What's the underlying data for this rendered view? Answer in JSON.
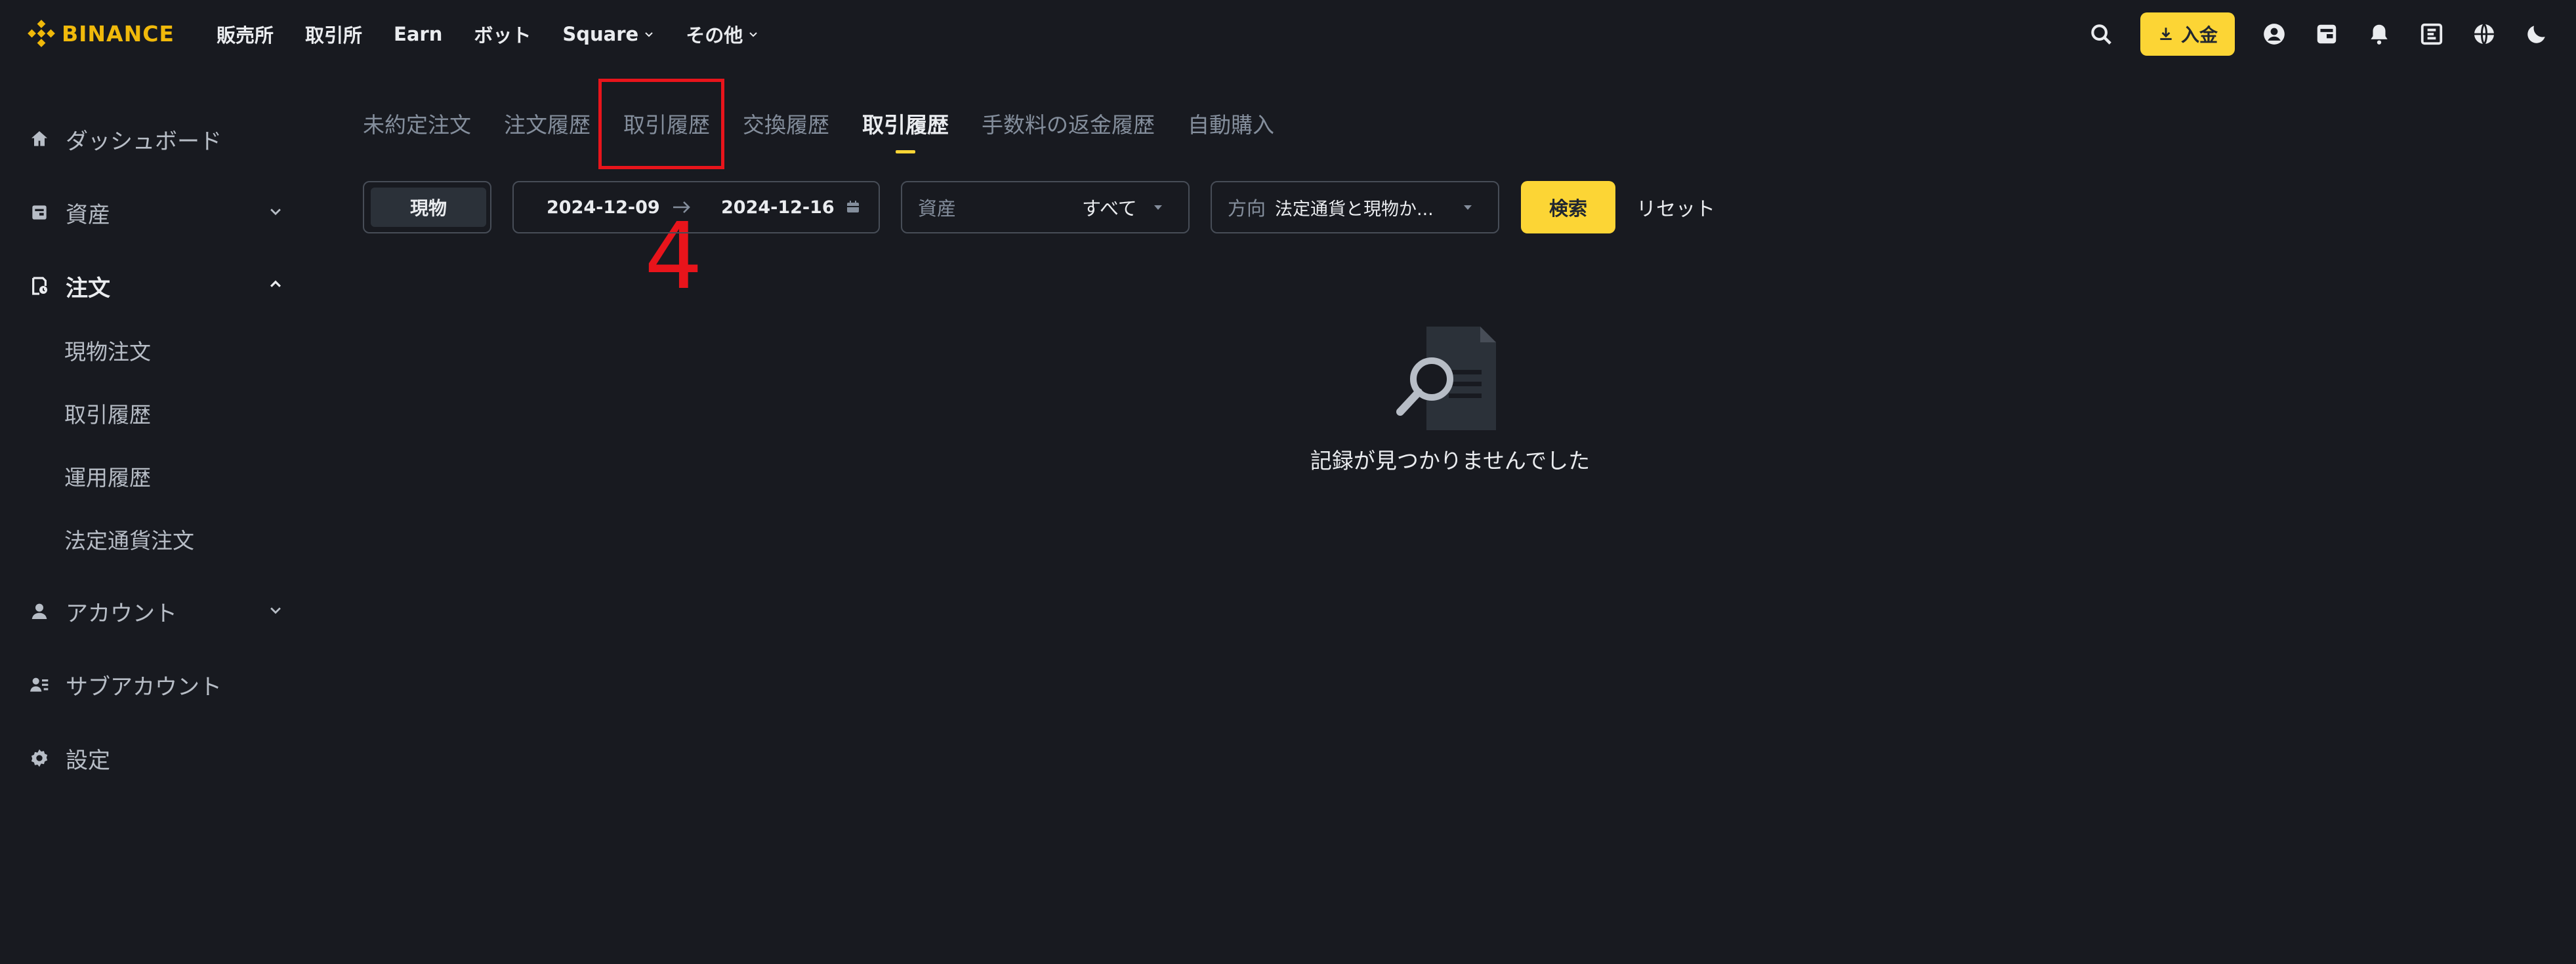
{
  "brand": {
    "name": "BINANCE",
    "accent": "#f0b90b"
  },
  "nav": {
    "items": [
      "販売所",
      "取引所",
      "Earn",
      "ボット",
      "Square",
      "その他"
    ],
    "deposit_label": "入金"
  },
  "sidebar": {
    "items": [
      {
        "label": "ダッシュボード",
        "icon": "home-icon"
      },
      {
        "label": "資産",
        "icon": "wallet-icon"
      },
      {
        "label": "注文",
        "icon": "order-icon"
      },
      {
        "label": "アカウント",
        "icon": "user-icon"
      },
      {
        "label": "サブアカウント",
        "icon": "sub-account-icon"
      },
      {
        "label": "設定",
        "icon": "gear-icon"
      }
    ],
    "sub_items": [
      "現物注文",
      "取引履歴",
      "運用履歴",
      "法定通貨注文"
    ]
  },
  "tabs": [
    "未約定注文",
    "注文履歴",
    "取引履歴",
    "交換履歴",
    "取引履歴",
    "手数料の返金履歴",
    "自動購入"
  ],
  "annotation": {
    "number": "4"
  },
  "filters": {
    "market": "現物",
    "date_from": "2024-12-09",
    "date_to": "2024-12-16",
    "asset_label": "資産",
    "asset_value": "すべて",
    "direction_label": "方向",
    "direction_value": "法定通貨と現物か...",
    "search_label": "検索",
    "reset_label": "リセット"
  },
  "empty": {
    "message": "記録が見つかりませんでした"
  }
}
